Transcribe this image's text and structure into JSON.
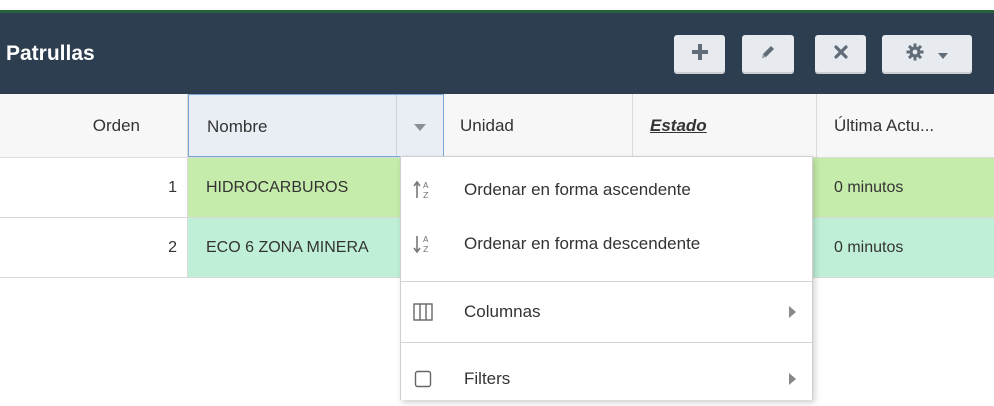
{
  "header": {
    "title": "Patrullas",
    "accent_color": "#27613f",
    "background": "#2c3e50",
    "toolbar": [
      {
        "name": "add-button",
        "icon": "plus-icon"
      },
      {
        "name": "edit-button",
        "icon": "pencil-icon"
      },
      {
        "name": "delete-button",
        "icon": "close-icon"
      },
      {
        "name": "settings-button",
        "icon": "gear-icon",
        "dropdown": true
      }
    ]
  },
  "grid": {
    "columns": [
      {
        "key": "orden",
        "label": "Orden"
      },
      {
        "key": "nombre",
        "label": "Nombre"
      },
      {
        "key": "unidad",
        "label": "Unidad"
      },
      {
        "key": "estado",
        "label": "Estado"
      },
      {
        "key": "ultima",
        "label": "Última Actu..."
      }
    ],
    "rows": [
      {
        "orden": "1",
        "nombre": "HIDROCARBUROS",
        "unidad": "",
        "estado": "",
        "ultima": "0 minutos",
        "color": "#c6ecab"
      },
      {
        "orden": "2",
        "nombre": "ECO 6 ZONA MINERA",
        "unidad": "",
        "estado": "",
        "ultima": "0 minutos",
        "color": "#bff0d7"
      }
    ]
  },
  "column_menu": {
    "items": [
      {
        "label": "Ordenar en forma ascendente",
        "icon": "sort-ascending-icon"
      },
      {
        "label": "Ordenar en forma descendente",
        "icon": "sort-descending-icon"
      },
      {
        "label": "Columnas",
        "icon": "columns-icon",
        "submenu": true
      },
      {
        "label": "Filters",
        "icon": "checkbox-icon",
        "submenu": true
      }
    ]
  }
}
